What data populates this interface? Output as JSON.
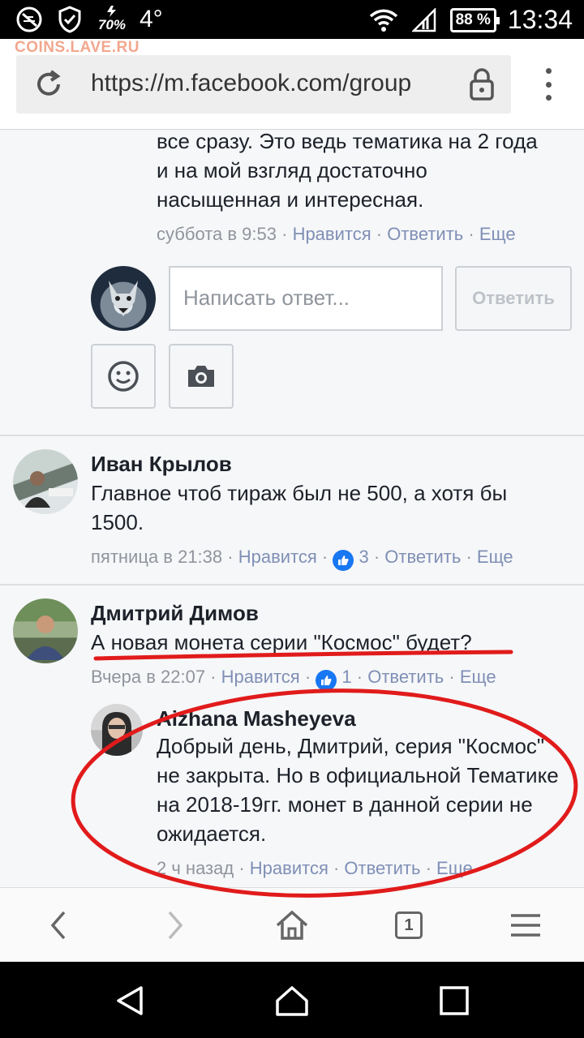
{
  "status_bar": {
    "battery_saver": "70%",
    "temperature": "4°",
    "battery": "88 %",
    "time": "13:34"
  },
  "watermark": "COINS.LAVE.RU",
  "address_bar": {
    "url": "https://m.facebook.com/group"
  },
  "comments": {
    "prev_reply": {
      "text": "все сразу. Это ведь тематика на 2 года и на мой взгляд достаточно насыщенная и интересная.",
      "time": "суббота в 9:53",
      "like": "Нравится",
      "reply": "Ответить",
      "more": "Еще"
    },
    "composer": {
      "placeholder": "Написать ответ...",
      "submit": "Ответить"
    },
    "c1": {
      "author": "Иван Крылов",
      "text": "Главное чтоб тираж был не 500, а хотя бы 1500.",
      "time": "пятница в 21:38",
      "like": "Нравится",
      "likes_count": "3",
      "reply": "Ответить",
      "more": "Еще"
    },
    "c2": {
      "author": "Дмитрий Димов",
      "text": "А новая монета серии \"Космос\" будет?",
      "time": "Вчера в 22:07",
      "like": "Нравится",
      "likes_count": "1",
      "reply": "Ответить",
      "more": "Еще"
    },
    "c2_reply": {
      "author": "Aizhana Masheyeva",
      "text": "Добрый день, Дмитрий, серия \"Космос\" не закрыта. Но в официальной Тематике на 2018-19гг. монет в данной серии не ожидается.",
      "time": "2 ч назад",
      "like": "Нравится",
      "reply": "Ответить",
      "more": "Еще"
    }
  },
  "toolbar": {
    "tab_count": "1"
  },
  "icons": {
    "status": [
      "no-sim-icon",
      "shield-icon",
      "battery-saver-icon",
      "wifi-icon",
      "signal-icon",
      "battery-icon"
    ],
    "address": [
      "reload-icon",
      "lock-icon",
      "overflow-menu-icon"
    ],
    "composer": [
      "emoji-icon",
      "camera-icon"
    ],
    "toolbar": [
      "back-icon",
      "forward-icon",
      "home-icon",
      "tabs-icon",
      "hamburger-menu-icon"
    ],
    "nav": [
      "nav-back-icon",
      "nav-home-icon",
      "nav-recents-icon"
    ]
  },
  "colors": {
    "link": "#7f8fb5",
    "meta": "#90949c",
    "like_blue": "#1877f2",
    "annotation_red": "#e11b1b"
  }
}
